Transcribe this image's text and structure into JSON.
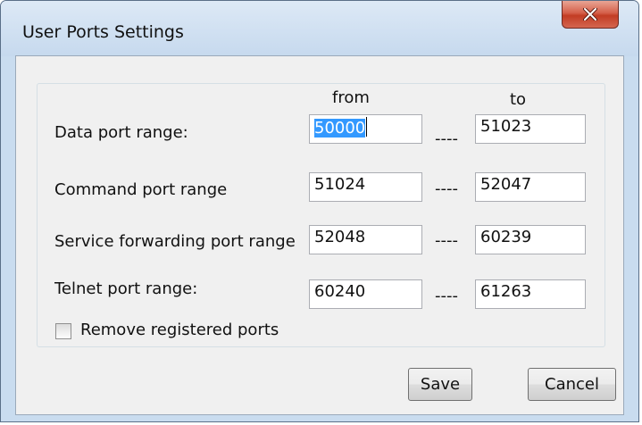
{
  "window": {
    "title": "User Ports Settings",
    "close_icon": "close-x-icon"
  },
  "columns": {
    "from": "from",
    "to": "to"
  },
  "separator": "----",
  "rows": [
    {
      "label": "Data port range:",
      "from": "50000",
      "to": "51023",
      "from_selected": true
    },
    {
      "label": "Command port range",
      "from": "51024",
      "to": "52047"
    },
    {
      "label": "Service forwarding port range",
      "from": "52048",
      "to": "60239"
    },
    {
      "label": "Telnet port range:",
      "from": "60240",
      "to": "61263"
    }
  ],
  "checkbox": {
    "label": "Remove registered ports",
    "checked": false
  },
  "buttons": {
    "save": "Save",
    "cancel": "Cancel"
  },
  "colors": {
    "selection": "#3399ff",
    "close_button": "#c23c24",
    "window_frame": "#c9dcef"
  }
}
